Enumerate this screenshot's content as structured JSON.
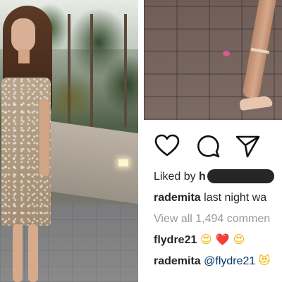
{
  "photos": {
    "left_alt": "woman in sequin slip dress on terrace",
    "right_alt": "foot in clear heeled sandal on paving"
  },
  "post": {
    "liked_by_label": "Liked by",
    "liked_by_initial": "h",
    "caption_user": "rademita",
    "caption_text": "last night wa",
    "view_all_comments": "View all 1,494 commen",
    "comments": [
      {
        "user": "flydre21",
        "text": "😍❤️😍"
      },
      {
        "user": "rademita",
        "mention": "@flydre21",
        "trailing": "😻"
      }
    ]
  },
  "colors": {
    "text": "#262626",
    "muted": "#9a9a9a",
    "mention": "#00376b",
    "heart_emoji": "#e0245e"
  },
  "icons": [
    "heart-icon",
    "comment-icon",
    "share-icon"
  ]
}
